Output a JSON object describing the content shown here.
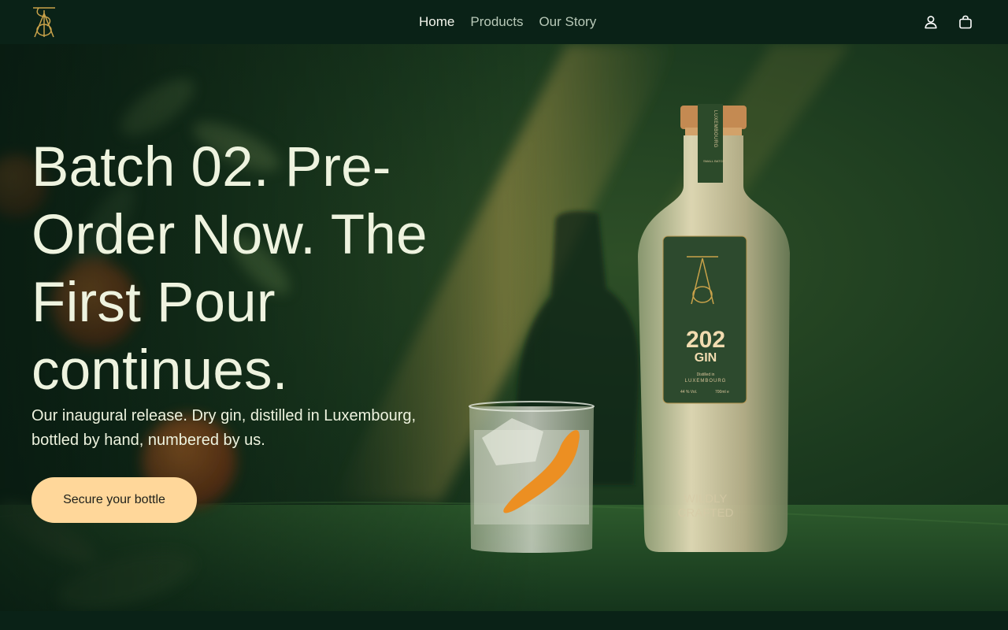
{
  "header": {
    "logo_icon": "202-gin-monogram-icon",
    "nav": [
      {
        "label": "Home",
        "active": true
      },
      {
        "label": "Products",
        "active": false
      },
      {
        "label": "Our Story",
        "active": false
      }
    ],
    "account_icon": "user-icon",
    "cart_icon": "shopping-bag-icon"
  },
  "hero": {
    "headline": "Batch 02. Pre-Order Now. The First Pour continues.",
    "subtext": "Our inaugural release. Dry gin, distilled in Luxembourg, bottled by hand, numbered by us.",
    "cta_label": "Secure your bottle",
    "bottle_label": {
      "neck": "LUXEMBOURG",
      "neck_small": "SMALL BATCH",
      "brand_number": "202",
      "brand_word": "GIN",
      "distilled_in": "Distilled in",
      "origin": "LUXEMBOURG",
      "abv": "44 % Vol.",
      "volume": "700ml e",
      "emboss_1": "WILDLY",
      "emboss_2": "CRAFTED"
    }
  },
  "colors": {
    "header_bg": "#0a2217",
    "accent_button": "#ffd79a",
    "hero_text": "#eef3df",
    "nav_active": "#f3f5ec",
    "nav_inactive": "#b8c9b8",
    "gold": "#c9a24a"
  }
}
